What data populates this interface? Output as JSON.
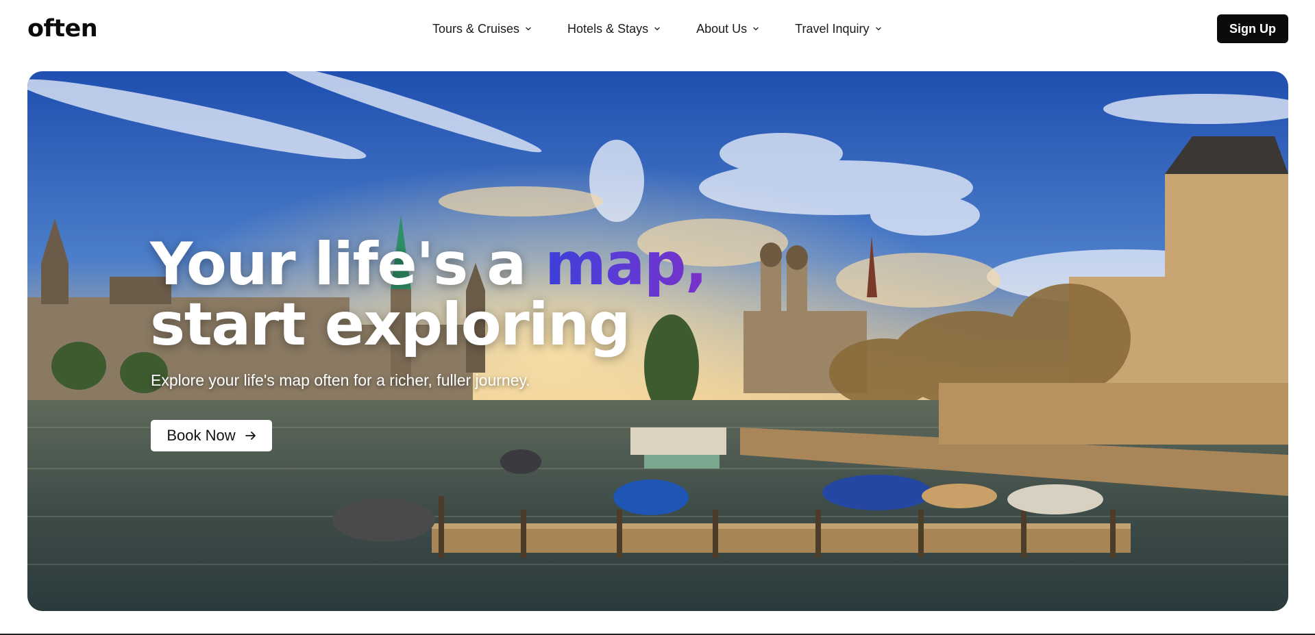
{
  "brand": {
    "logo_text": "often"
  },
  "nav": {
    "items": [
      {
        "label": "Tours & Cruises",
        "icon": "chevron-down-icon"
      },
      {
        "label": "Hotels & Stays",
        "icon": "chevron-down-icon"
      },
      {
        "label": "About Us",
        "icon": "chevron-down-icon"
      },
      {
        "label": "Travel Inquiry",
        "icon": "chevron-down-icon"
      }
    ],
    "signup_label": "Sign Up"
  },
  "hero": {
    "headline_part1": "Your life's a ",
    "headline_accent": "map,",
    "headline_part2": " start exploring",
    "subtitle": "Explore your life's map often for a richer, fuller journey.",
    "cta_label": "Book Now",
    "cta_icon": "arrow-right-icon",
    "image_subject": "city-riverfront-photo"
  },
  "colors": {
    "accent_gradient": [
      "#3b3fd9",
      "#7a30c9"
    ],
    "button_dark": "#0b0b0b",
    "sky_top": "#1f4fb0"
  }
}
